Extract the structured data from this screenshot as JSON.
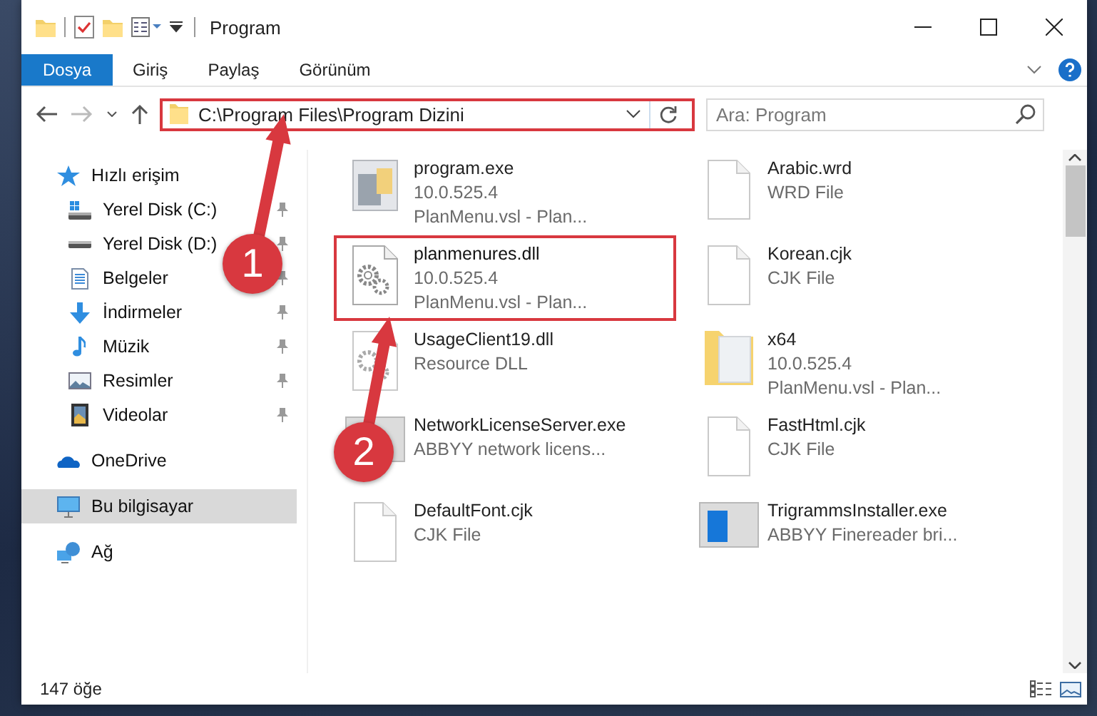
{
  "window": {
    "title": "Program"
  },
  "ribbon_tabs": [
    {
      "label": "Dosya",
      "selected": true
    },
    {
      "label": "Giriş",
      "selected": false
    },
    {
      "label": "Paylaş",
      "selected": false
    },
    {
      "label": "Görünüm",
      "selected": false
    }
  ],
  "address_bar": {
    "path": "C:\\Program Files\\Program Dizini",
    "highlighted": true
  },
  "search": {
    "placeholder": "Ara: Program"
  },
  "navigation": [
    {
      "label": "Hızlı erişim",
      "selected": false,
      "children": [
        {
          "label": "Yerel Disk (C:)",
          "pinned": true,
          "selected": false
        },
        {
          "label": "Yerel Disk (D:)",
          "pinned": true,
          "selected": false
        },
        {
          "label": "Belgeler",
          "pinned": true,
          "selected": false
        },
        {
          "label": "İndirmeler",
          "pinned": true,
          "selected": false
        },
        {
          "label": "Müzik",
          "pinned": true,
          "selected": false
        },
        {
          "label": "Resimler",
          "pinned": true,
          "selected": false
        },
        {
          "label": "Videolar",
          "pinned": true,
          "selected": false
        }
      ]
    },
    {
      "label": "OneDrive",
      "selected": false
    },
    {
      "label": "Bu bilgisayar",
      "selected": true
    },
    {
      "label": "Ağ",
      "selected": false
    }
  ],
  "files": [
    {
      "name": "program.exe",
      "details": [
        "10.0.525.4",
        "PlanMenu.vsl - Plan..."
      ],
      "highlighted": false
    },
    {
      "name": "Arabic.wrd",
      "details": [
        "WRD File"
      ],
      "highlighted": false
    },
    {
      "name": "planmenures.dll",
      "details": [
        "10.0.525.4",
        "PlanMenu.vsl - Plan..."
      ],
      "highlighted": true
    },
    {
      "name": "Korean.cjk",
      "details": [
        "CJK File"
      ],
      "highlighted": false
    },
    {
      "name": "UsageClient19.dll",
      "details": [
        "Resource DLL"
      ],
      "highlighted": false
    },
    {
      "name": "x64",
      "details": [
        "10.0.525.4",
        "PlanMenu.vsl - Plan..."
      ],
      "highlighted": false
    },
    {
      "name": "NetworkLicenseServer.exe",
      "details": [
        "ABBYY network licens..."
      ],
      "highlighted": false
    },
    {
      "name": "FastHtml.cjk",
      "details": [
        "CJK File"
      ],
      "highlighted": false
    },
    {
      "name": "DefaultFont.cjk",
      "details": [
        "CJK File"
      ],
      "highlighted": false
    },
    {
      "name": "TrigrammsInstaller.exe",
      "details": [
        "ABBYY Finereader bri..."
      ],
      "highlighted": false
    }
  ],
  "annotations": [
    {
      "label": "1"
    },
    {
      "label": "2"
    }
  ],
  "status_bar": {
    "item_count": "147 öğe"
  }
}
